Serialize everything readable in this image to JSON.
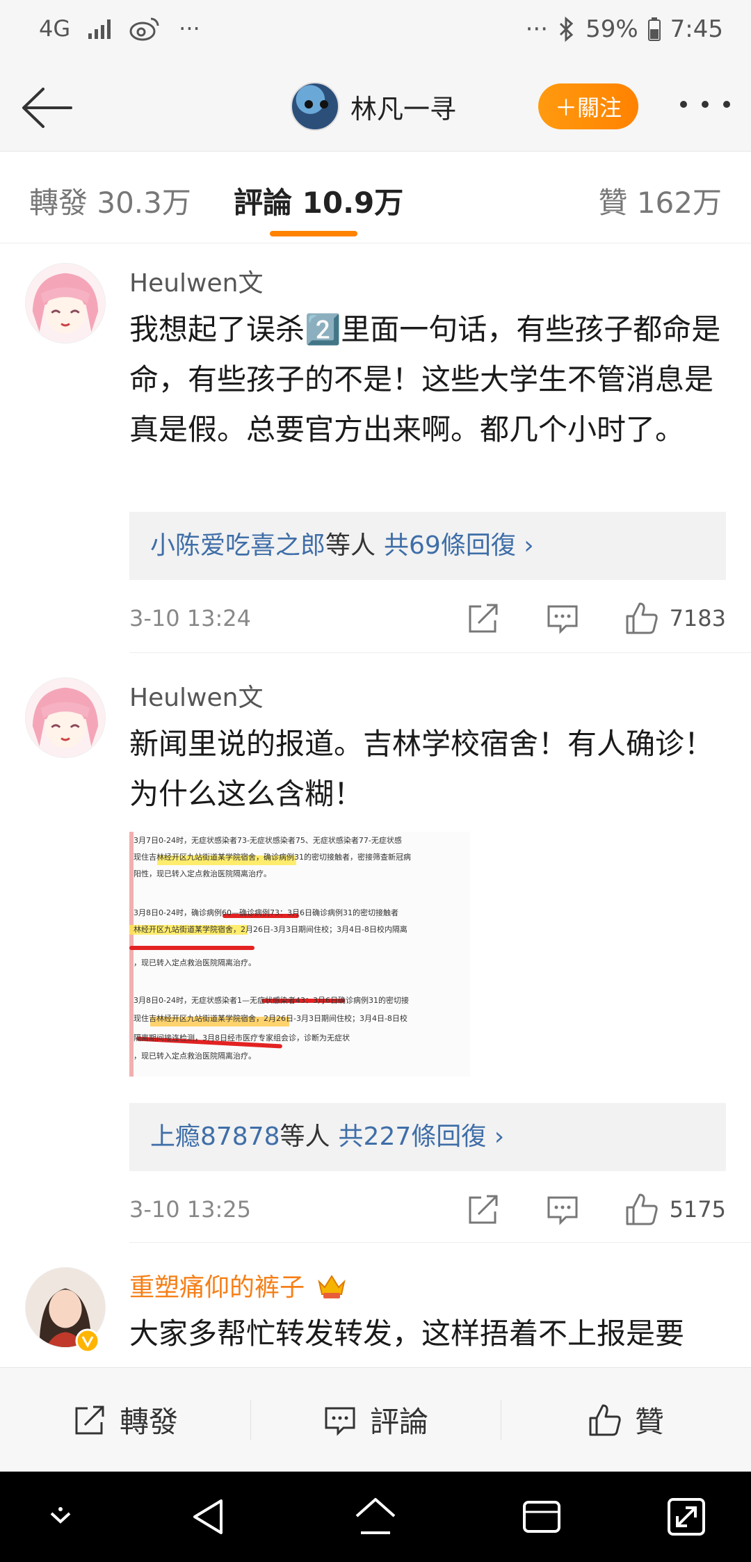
{
  "status_bar": {
    "network": "4G",
    "dots_left": "···",
    "dots_right": "···",
    "battery": "59%",
    "time": "7:45"
  },
  "header": {
    "username": "林凡一寻",
    "follow_label": "＋關注"
  },
  "tabs": {
    "repost": "轉發 30.3万",
    "comments": "評論 10.9万",
    "likes": "贊 162万"
  },
  "comments": [
    {
      "author": "Heulwen文",
      "text": "我想起了误杀2️⃣里面一句话，有些孩子都命是命，有些孩子的不是！这些大学生不管消息是真是假。总要官方出来啊。都几个小时了。",
      "replies_prefix": "小陈爱吃喜之郎",
      "replies_mid": "等人",
      "replies_count": "共69條回復 ›",
      "time": "3-10 13:24",
      "likes": "7183"
    },
    {
      "author": "Heulwen文",
      "text": "新闻里说的报道。吉林学校宿舍！有人确诊！为什么这么含糊！",
      "replies_prefix": "上瘾87878",
      "replies_mid": "等人",
      "replies_count": "共227條回復 ›",
      "time": "3-10 13:25",
      "likes": "5175"
    },
    {
      "author": "重塑痛仰的裤子",
      "text": "大家多帮忙转发转发，这样捂着不上报是要"
    }
  ],
  "news_image": {
    "lines": [
      "3月7日0-24时，无症状感染者73-无症状感染者75、无症状感染者77-无症状感",
      "现住吉林经开区九站街道某学院宿舍，确诊病例31的密切接触者，密接筛查新冠病",
      "阳性，现已转入定点救治医院隔离治疗。",
      "3月8日0-24时，确诊病例60—确诊病例73：3月6日确诊病例31的密切接触者",
      "林经开区九站街道某学院宿舍，2月26日-3月3日期间住校；3月4日-8日校内隔离",
      "，现已转入定点救治医院隔离治疗。",
      "3月8日0-24时，无症状感染者1—无症状感染者43：3月6日确诊病例31的密切接",
      "现住吉林经开区九站街道某学院宿舍，2月26日-3月3日期间住校；3月4日-8日校",
      "隔离期间接连检测，3月8日经市医疗专家组会诊，诊断为无症状",
      "，现已转入定点救治医院隔离治疗。"
    ]
  },
  "action_bar": {
    "repost": "轉發",
    "comment": "評論",
    "like": "贊"
  },
  "colors": {
    "accent": "#ff8200",
    "link": "#3f6ea8",
    "vip_name": "#f57f17"
  }
}
